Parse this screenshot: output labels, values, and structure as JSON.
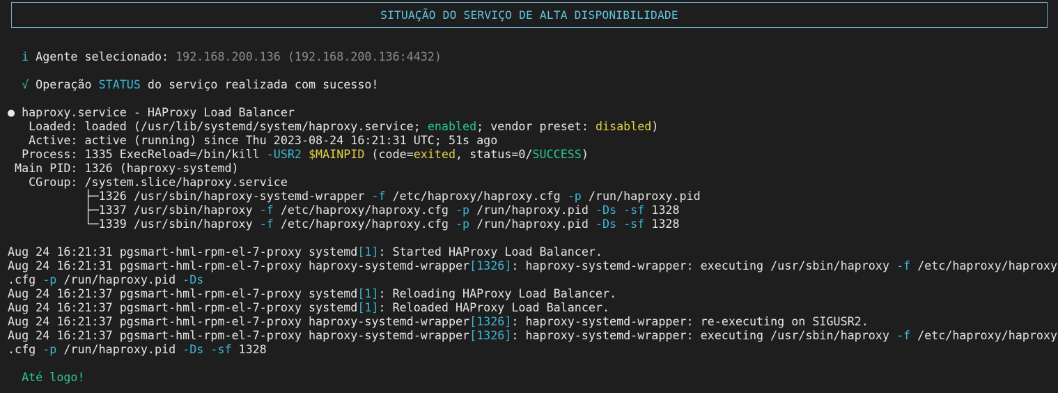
{
  "banner": {
    "title": "SITUAÇÃO DO SERVIÇO DE ALTA DISPONIBILIDADE"
  },
  "info": {
    "icon_glyph": "i",
    "label": " Agente selecionado: ",
    "value": "192.168.200.136 (192.168.200.136:4432)"
  },
  "result": {
    "icon_glyph": "√",
    "prefix": " Operação ",
    "op": "STATUS",
    "suffix": " do serviço realizada com sucesso!"
  },
  "status": {
    "bullet": "●",
    "header": " haproxy.service - HAProxy Load Balancer",
    "loaded_pre": "   Loaded: loaded (/usr/lib/systemd/system/haproxy.service; ",
    "loaded_enabled": "enabled",
    "loaded_mid": "; vendor preset: ",
    "loaded_disabled": "disabled",
    "loaded_post": ")",
    "active": "   Active: active (running) since Thu 2023-08-24 16:21:31 UTC; 51s ago",
    "process_pre": "  Process: 1335 ExecReload=/bin/kill ",
    "process_flag": "-USR2",
    "process_sp": " ",
    "process_var": "$MAINPID",
    "process_mid1": " (code=",
    "process_exited": "exited",
    "process_mid2": ", status=0/",
    "process_success": "SUCCESS",
    "process_post": ")",
    "mainpid": " Main PID: 1326 (haproxy-systemd)",
    "cgroup": "   CGroup: /system.slice/haproxy.service",
    "tree": [
      {
        "prefix": "           ├─1326 /usr/sbin/haproxy-systemd-wrapper ",
        "parts": [
          "-f",
          " /etc/haproxy/haproxy.cfg ",
          "-p",
          " /run/haproxy.pid"
        ]
      },
      {
        "prefix": "           ├─1337 /usr/sbin/haproxy ",
        "parts": [
          "-f",
          " /etc/haproxy/haproxy.cfg ",
          "-p",
          " /run/haproxy.pid ",
          "-Ds",
          " ",
          "-sf",
          " 1328"
        ]
      },
      {
        "prefix": "           └─1339 /usr/sbin/haproxy ",
        "parts": [
          "-f",
          " /etc/haproxy/haproxy.cfg ",
          "-p",
          " /run/haproxy.pid ",
          "-Ds",
          " ",
          "-sf",
          " 1328"
        ]
      }
    ]
  },
  "log": {
    "host_prefix": "Aug 24 16:21:31 pgsmart-hml-rpm-el-7-proxy ",
    "lines": [
      {
        "pre": "Aug 24 16:21:31 pgsmart-hml-rpm-el-7-proxy systemd",
        "pid": "[1]",
        "msg": ": Started HAProxy Load Balancer."
      },
      {
        "pre": "Aug 24 16:21:31 pgsmart-hml-rpm-el-7-proxy haproxy-systemd-wrapper",
        "pid": "[1326]",
        "msg": ": haproxy-systemd-wrapper: executing /usr/sbin/haproxy ",
        "f": "-f",
        "path": " /etc/haproxy/haproxy"
      },
      {
        "cont_pre": ".cfg ",
        "p": "-p",
        "cont_mid": " /run/haproxy.pid ",
        "ds": "-Ds"
      },
      {
        "pre": "Aug 24 16:21:37 pgsmart-hml-rpm-el-7-proxy systemd",
        "pid": "[1]",
        "msg": ": Reloading HAProxy Load Balancer."
      },
      {
        "pre": "Aug 24 16:21:37 pgsmart-hml-rpm-el-7-proxy systemd",
        "pid": "[1]",
        "msg": ": Reloaded HAProxy Load Balancer."
      },
      {
        "pre": "Aug 24 16:21:37 pgsmart-hml-rpm-el-7-proxy haproxy-systemd-wrapper",
        "pid": "[1326]",
        "msg": ": haproxy-systemd-wrapper: re-executing on SIGUSR2."
      },
      {
        "pre": "Aug 24 16:21:37 pgsmart-hml-rpm-el-7-proxy haproxy-systemd-wrapper",
        "pid": "[1326]",
        "msg": ": haproxy-systemd-wrapper: executing /usr/sbin/haproxy ",
        "f": "-f",
        "path": " /etc/haproxy/haproxy"
      },
      {
        "cont_pre": ".cfg ",
        "p": "-p",
        "cont_mid": " /run/haproxy.pid ",
        "ds": "-Ds",
        "sp": " ",
        "sf": "-sf",
        "end": " 1328"
      }
    ]
  },
  "farewell": "Até logo!",
  "colors": {
    "background": "#1e1e1e",
    "text": "#e6e6e6",
    "cyan": "#3bb8d8",
    "green": "#29c98a",
    "yellow": "#e4d046",
    "dim": "#8c8c8c",
    "banner_border": "#6fb0c6"
  }
}
